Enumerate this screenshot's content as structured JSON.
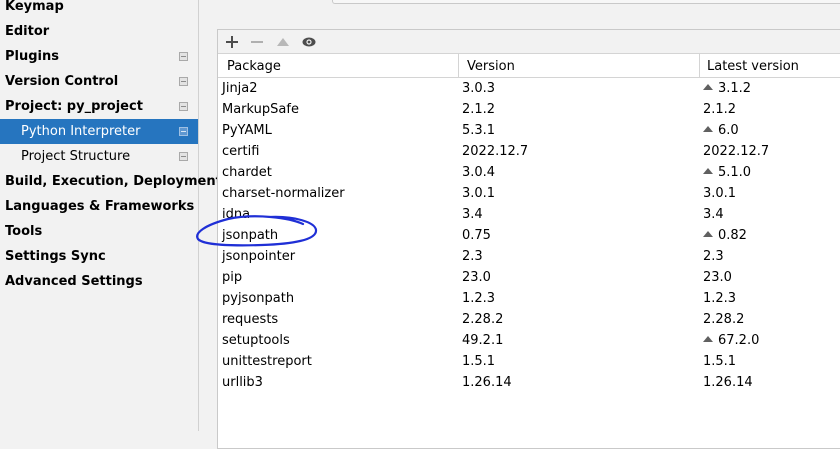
{
  "sidebar": {
    "items": [
      {
        "label": "Keymap"
      },
      {
        "label": "Editor"
      },
      {
        "label": "Plugins"
      },
      {
        "label": "Version Control"
      },
      {
        "label": "Project: py_project"
      },
      {
        "label": "Python Interpreter"
      },
      {
        "label": "Project Structure"
      },
      {
        "label": "Build, Execution, Deployment"
      },
      {
        "label": "Languages & Frameworks"
      },
      {
        "label": "Tools"
      },
      {
        "label": "Settings Sync"
      },
      {
        "label": "Advanced Settings"
      }
    ],
    "selected_color": "#2675bf"
  },
  "toolbar": {
    "icons": [
      "plus-icon",
      "minus-icon",
      "upgrade-icon",
      "eye-icon"
    ]
  },
  "table": {
    "columns": [
      "Package",
      "Version",
      "Latest version"
    ],
    "rows": [
      {
        "package": "Jinja2",
        "version": "3.0.3",
        "latest": "3.1.2",
        "upgrade": true
      },
      {
        "package": "MarkupSafe",
        "version": "2.1.2",
        "latest": "2.1.2",
        "upgrade": false
      },
      {
        "package": "PyYAML",
        "version": "5.3.1",
        "latest": "6.0",
        "upgrade": true
      },
      {
        "package": "certifi",
        "version": "2022.12.7",
        "latest": "2022.12.7",
        "upgrade": false
      },
      {
        "package": "chardet",
        "version": "3.0.4",
        "latest": "5.1.0",
        "upgrade": true
      },
      {
        "package": "charset-normalizer",
        "version": "3.0.1",
        "latest": "3.0.1",
        "upgrade": false
      },
      {
        "package": "idna",
        "version": "3.4",
        "latest": "3.4",
        "upgrade": false
      },
      {
        "package": "jsonpath",
        "version": "0.75",
        "latest": "0.82",
        "upgrade": true
      },
      {
        "package": "jsonpointer",
        "version": "2.3",
        "latest": "2.3",
        "upgrade": false
      },
      {
        "package": "pip",
        "version": "23.0",
        "latest": "23.0",
        "upgrade": false
      },
      {
        "package": "pyjsonpath",
        "version": "1.2.3",
        "latest": "1.2.3",
        "upgrade": false
      },
      {
        "package": "requests",
        "version": "2.28.2",
        "latest": "2.28.2",
        "upgrade": false
      },
      {
        "package": "setuptools",
        "version": "49.2.1",
        "latest": "67.2.0",
        "upgrade": true
      },
      {
        "package": "unittestreport",
        "version": "1.5.1",
        "latest": "1.5.1",
        "upgrade": false
      },
      {
        "package": "urllib3",
        "version": "1.26.14",
        "latest": "1.26.14",
        "upgrade": false
      }
    ]
  },
  "annotation": {
    "color": "#1f2fd6"
  }
}
